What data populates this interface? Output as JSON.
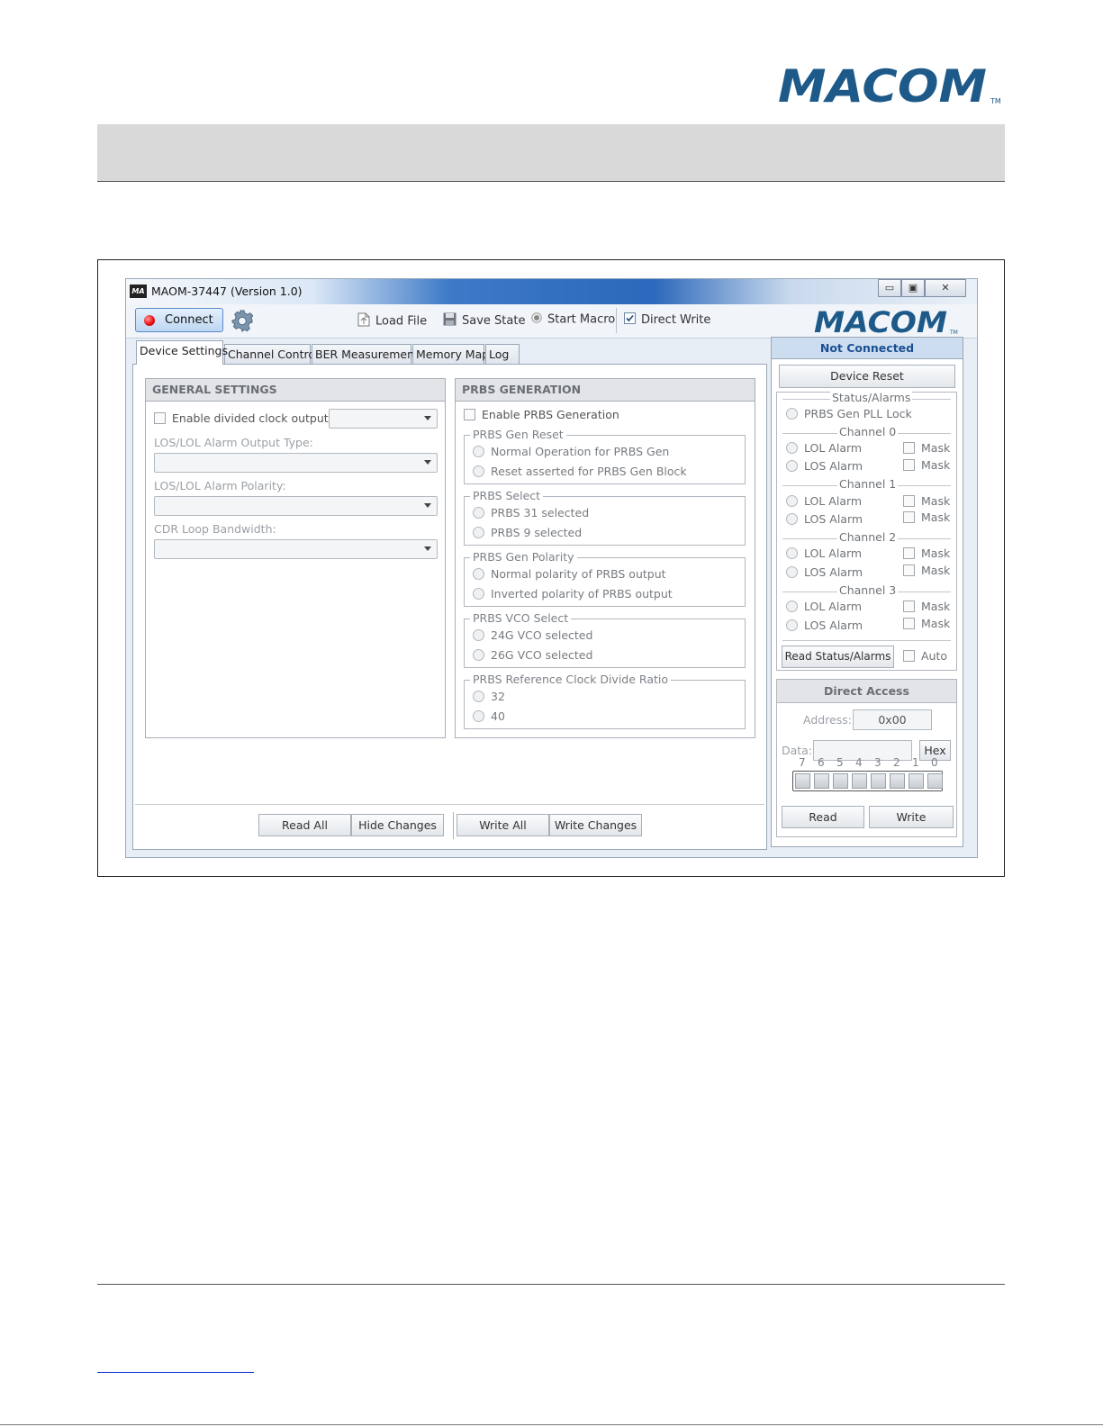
{
  "page": {
    "logo_text": "MACOM",
    "logo_tm": "TM"
  },
  "window": {
    "title": "MAOM-37447 (Version 1.0)",
    "icon_text": "MA",
    "min_glyph": "▭",
    "max_glyph": "▣",
    "close_glyph": "✕"
  },
  "toolbar": {
    "connect_label": "Connect",
    "load_file": "Load File",
    "save_state": "Save State",
    "start_macro": "Start Macro",
    "direct_write": "Direct Write",
    "direct_write_checked": true,
    "logo_text": "MACOM",
    "logo_tm": "TM"
  },
  "tabs": [
    {
      "label": "Device Settings",
      "active": true
    },
    {
      "label": "Channel Control",
      "active": false
    },
    {
      "label": "BER Measurement",
      "active": false
    },
    {
      "label": "Memory Map",
      "active": false
    },
    {
      "label": "Log",
      "active": false
    }
  ],
  "general_settings": {
    "title": "GENERAL SETTINGS",
    "enable_divided_clock": "Enable divided clock output:",
    "alarm_output_type": "LOS/LOL Alarm Output Type:",
    "alarm_polarity": "LOS/LOL Alarm Polarity:",
    "cdr_bandwidth": "CDR Loop Bandwidth:"
  },
  "prbs_generation": {
    "title": "PRBS GENERATION",
    "enable": "Enable PRBS Generation",
    "groups": [
      {
        "legend": "PRBS Gen Reset",
        "options": [
          "Normal Operation for PRBS Gen",
          "Reset asserted for PRBS Gen Block"
        ]
      },
      {
        "legend": "PRBS Select",
        "options": [
          "PRBS 31 selected",
          "PRBS 9 selected"
        ]
      },
      {
        "legend": "PRBS Gen Polarity",
        "options": [
          "Normal polarity of PRBS output",
          "Inverted polarity of PRBS output"
        ]
      },
      {
        "legend": "PRBS VCO Select",
        "options": [
          "24G VCO selected",
          "26G VCO selected"
        ]
      },
      {
        "legend": "PRBS Reference Clock Divide Ratio",
        "options": [
          "32",
          "40"
        ]
      }
    ]
  },
  "bottom_buttons": {
    "read_all": "Read All",
    "hide_changes": "Hide Changes",
    "write_all": "Write All",
    "write_changes": "Write Changes"
  },
  "right_panel": {
    "status": "Not Connected",
    "device_reset": "Device Reset",
    "status_alarms_title": "Status/Alarms",
    "pll_lock": "PRBS Gen PLL Lock",
    "channels": [
      {
        "label": "Channel 0",
        "lol": "LOL Alarm",
        "los": "LOS Alarm",
        "mask": "Mask"
      },
      {
        "label": "Channel 1",
        "lol": "LOL Alarm",
        "los": "LOS Alarm",
        "mask": "Mask"
      },
      {
        "label": "Channel 2",
        "lol": "LOL Alarm",
        "los": "LOS Alarm",
        "mask": "Mask"
      },
      {
        "label": "Channel 3",
        "lol": "LOL Alarm",
        "los": "LOS Alarm",
        "mask": "Mask"
      }
    ],
    "read_status": "Read Status/Alarms",
    "auto": "Auto",
    "direct_access_title": "Direct Access",
    "address_label": "Address:",
    "address_value": "0x00",
    "data_label": "Data:",
    "data_value": "",
    "hex": "Hex",
    "bits": [
      "7",
      "6",
      "5",
      "4",
      "3",
      "2",
      "1",
      "0"
    ],
    "read": "Read",
    "write": "Write"
  },
  "colors": {
    "brand": "#1d5a8a",
    "status_text": "#1b4f93",
    "led": "#e11111",
    "link": "#1f3fd1"
  }
}
